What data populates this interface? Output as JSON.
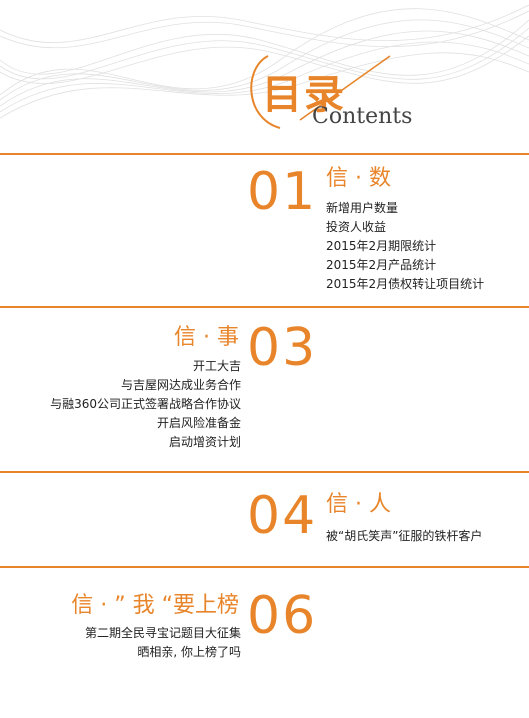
{
  "header": {
    "title_cn": "目录",
    "title_en": "Contents"
  },
  "sections": [
    {
      "number": "01",
      "heading": "信 · 数",
      "items": [
        "新增用户数量",
        "投资人收益",
        "2015年2月期限统计",
        "2015年2月产品统计",
        "2015年2月债权转让项目统计"
      ]
    },
    {
      "number": "03",
      "heading": "信 · 事",
      "items": [
        "开工大吉",
        "与吉屋网达成业务合作",
        "与融360公司正式签署战略合作协议",
        "开启风险准备金",
        "启动增资计划"
      ]
    },
    {
      "number": "04",
      "heading": "信 · 人",
      "items": [
        "被“胡氏笑声”征服的铁杆客户"
      ]
    },
    {
      "number": "06",
      "heading": "信 · ” 我 “要上榜",
      "items": [
        "第二期全民寻宝记题目大征集",
        "晒相亲, 你上榜了吗"
      ]
    }
  ],
  "colors": {
    "accent": "#e8852a",
    "text": "#222222"
  }
}
